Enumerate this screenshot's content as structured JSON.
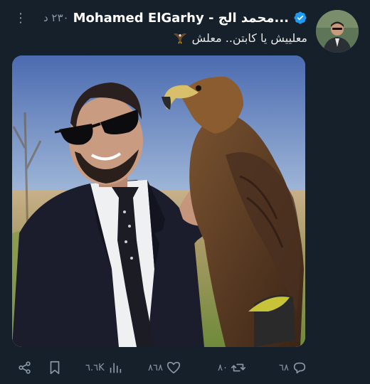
{
  "header": {
    "time": "٢٣٠ د",
    "name": "Mohamed ElGarhy - محمد الج...",
    "more_icon": "more-vertical-icon",
    "verified_icon": "verified-badge-icon"
  },
  "tweet": {
    "text": "معلييش يا كابتن.. معلش",
    "emoji": "eagle-emoji"
  },
  "actions": {
    "replies": "٦٨",
    "retweets": "٨٠",
    "likes": "٨٦٨",
    "views": "٦.٦K",
    "reply_icon": "reply-icon",
    "retweet_icon": "retweet-icon",
    "like_icon": "heart-icon",
    "views_icon": "views-icon",
    "bookmark_icon": "bookmark-icon",
    "share_icon": "share-icon"
  },
  "colors": {
    "background": "#15202b",
    "muted": "#8b98a5",
    "verified": "#1d9bf0"
  }
}
